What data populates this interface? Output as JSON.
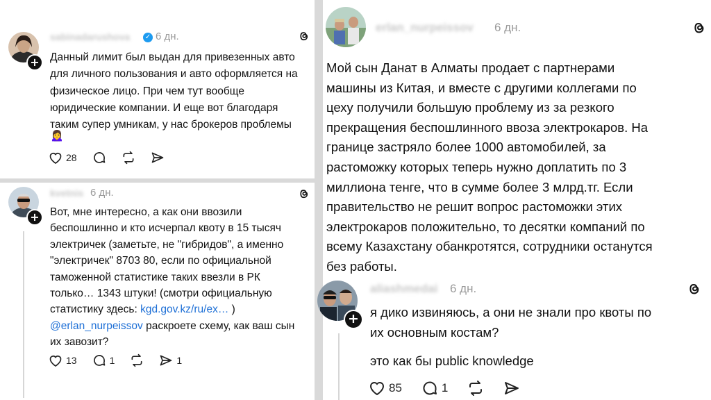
{
  "post1": {
    "username": "sabinadarushova",
    "time": "6 дн.",
    "text": "Данный лимит был выдан для привезенных авто\nдля личного пользования и авто оформляется на\nфизическое лицо. При чем тут вообще\nюридические компании. И еще вот благодаря\nтаким супер умникам, у нас брокеров проблемы",
    "emoji": "🙍‍♀️",
    "likes": "28"
  },
  "post2": {
    "username": "kvetnis",
    "time": "6 дн.",
    "text": "Вот, мне интересно, а как они ввозили\nбеспошлинно и кто исчерпал квоту в 15 тысяч\nэлектричек (заметьте, не \"гибридов\", а именно\n\"электричек\" 8703 80, если по официальной\nтаможенной статистике таких ввезли в РК\nтолько… 1343 штуки! (смотри официальную\nстатистику здесь: ",
    "link": "kgd.gov.kz/ru/ex…",
    "after_link": " )",
    "mention": "@erlan_nurpeissov",
    "text_end": " раскроете схему, как ваш сын\nих завозит?",
    "likes": "13",
    "comments": "1",
    "shares": "1"
  },
  "post3": {
    "username": "erlan_nurpeissov",
    "time": "6 дн.",
    "text": "Мой сын Данат в Алматы продает с партнерами\nмашины из Китая, и вместе с другими коллегами по\nцеху получили большую проблему из за резкого\nпрекращения беспошлинного ввоза электрокаров. На\nгранице застряло более 1000 автомобилей, за\nрастоможку  которых теперь нужно доплатить по 3\nмиллиона тенге, что в сумме более 3 млрд.тг. Если\nправительство не решит вопрос растоможки этих\nэлектрокаров положительно, то десятки компаний по\nвсему Казахстану обанкротятся, сотрудники  останутся\nбез работы."
  },
  "post4": {
    "username": "aliashmedai",
    "time": "6 дн.",
    "text": "я дико извиняюсь, а они не знали про квоты по\nих основным костам?",
    "text2": "это как бы public knowledge",
    "likes": "85",
    "comments": "1"
  },
  "icons": {
    "threads": "threads-logo-icon",
    "like": "heart-icon",
    "comment": "comment-icon",
    "repost": "repost-icon",
    "share": "share-icon",
    "follow": "plus-icon",
    "verified": "verified-check-icon"
  }
}
